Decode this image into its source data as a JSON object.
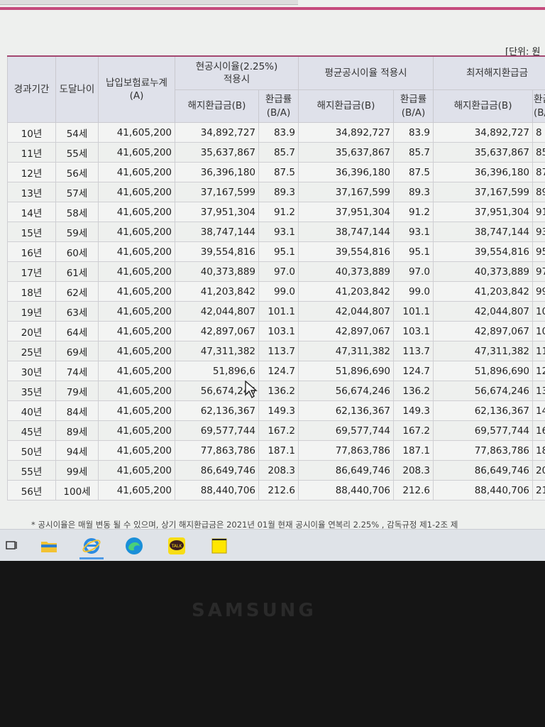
{
  "unit_label": "[단위: 원",
  "headers": {
    "period": "경과기간",
    "age": "도달나이",
    "premium": "납입보험료누계\n(A)",
    "current_group": "현공시이율(2.25%)\n적용시",
    "avg_group": "평균공시이율 적용시",
    "min_group": "최저해지환급금",
    "refund_b": "해지환급금(B)",
    "ratio": "환급률\n(B/A)",
    "ratio_cut": "환급\n(B/"
  },
  "rows": [
    [
      "10년",
      "54세",
      "41,605,200",
      "34,892,727",
      "83.9",
      "34,892,727",
      "83.9",
      "34,892,727",
      "8"
    ],
    [
      "11년",
      "55세",
      "41,605,200",
      "35,637,867",
      "85.7",
      "35,637,867",
      "85.7",
      "35,637,867",
      "85"
    ],
    [
      "12년",
      "56세",
      "41,605,200",
      "36,396,180",
      "87.5",
      "36,396,180",
      "87.5",
      "36,396,180",
      "87"
    ],
    [
      "13년",
      "57세",
      "41,605,200",
      "37,167,599",
      "89.3",
      "37,167,599",
      "89.3",
      "37,167,599",
      "89"
    ],
    [
      "14년",
      "58세",
      "41,605,200",
      "37,951,304",
      "91.2",
      "37,951,304",
      "91.2",
      "37,951,304",
      "91."
    ],
    [
      "15년",
      "59세",
      "41,605,200",
      "38,747,144",
      "93.1",
      "38,747,144",
      "93.1",
      "38,747,144",
      "93."
    ],
    [
      "16년",
      "60세",
      "41,605,200",
      "39,554,816",
      "95.1",
      "39,554,816",
      "95.1",
      "39,554,816",
      "95.1"
    ],
    [
      "17년",
      "61세",
      "41,605,200",
      "40,373,889",
      "97.0",
      "40,373,889",
      "97.0",
      "40,373,889",
      "97.0"
    ],
    [
      "18년",
      "62세",
      "41,605,200",
      "41,203,842",
      "99.0",
      "41,203,842",
      "99.0",
      "41,203,842",
      "99.0"
    ],
    [
      "19년",
      "63세",
      "41,605,200",
      "42,044,807",
      "101.1",
      "42,044,807",
      "101.1",
      "42,044,807",
      "101.1"
    ],
    [
      "20년",
      "64세",
      "41,605,200",
      "42,897,067",
      "103.1",
      "42,897,067",
      "103.1",
      "42,897,067",
      "103.1"
    ],
    [
      "25년",
      "69세",
      "41,605,200",
      "47,311,382",
      "113.7",
      "47,311,382",
      "113.7",
      "47,311,382",
      "113.7"
    ],
    [
      "30년",
      "74세",
      "41,605,200",
      "51,896,6",
      "124.7",
      "51,896,690",
      "124.7",
      "51,896,690",
      "124.7"
    ],
    [
      "35년",
      "79세",
      "41,605,200",
      "56,674,246",
      "136.2",
      "56,674,246",
      "136.2",
      "56,674,246",
      "136.2"
    ],
    [
      "40년",
      "84세",
      "41,605,200",
      "62,136,367",
      "149.3",
      "62,136,367",
      "149.3",
      "62,136,367",
      "149.3"
    ],
    [
      "45년",
      "89세",
      "41,605,200",
      "69,577,744",
      "167.2",
      "69,577,744",
      "167.2",
      "69,577,744",
      "167.2"
    ],
    [
      "50년",
      "94세",
      "41,605,200",
      "77,863,786",
      "187.1",
      "77,863,786",
      "187.1",
      "77,863,786",
      "187.1"
    ],
    [
      "55년",
      "99세",
      "41,605,200",
      "86,649,746",
      "208.3",
      "86,649,746",
      "208.3",
      "86,649,746",
      "208.3"
    ],
    [
      "56년",
      "100세",
      "41,605,200",
      "88,440,706",
      "212.6",
      "88,440,706",
      "212.6",
      "88,440,706",
      "212.6"
    ]
  ],
  "footnote": "* 공시이율은 매월 변동 될 수 있으며, 상기 해지환급금은 2021년 01월 현재 공시이율 연복리 2.25% , 감독규정 제1-2조 제",
  "taskbar_icons": [
    "window-icon",
    "file-explorer-icon",
    "internet-explorer-icon",
    "edge-icon",
    "kakaotalk-icon",
    "sticky-notes-icon"
  ],
  "kakao_label": "TALK",
  "monitor_brand": "SAMSUNG",
  "colors": {
    "accent": "#c54b7d",
    "header_bg": "#dfe1ea"
  }
}
